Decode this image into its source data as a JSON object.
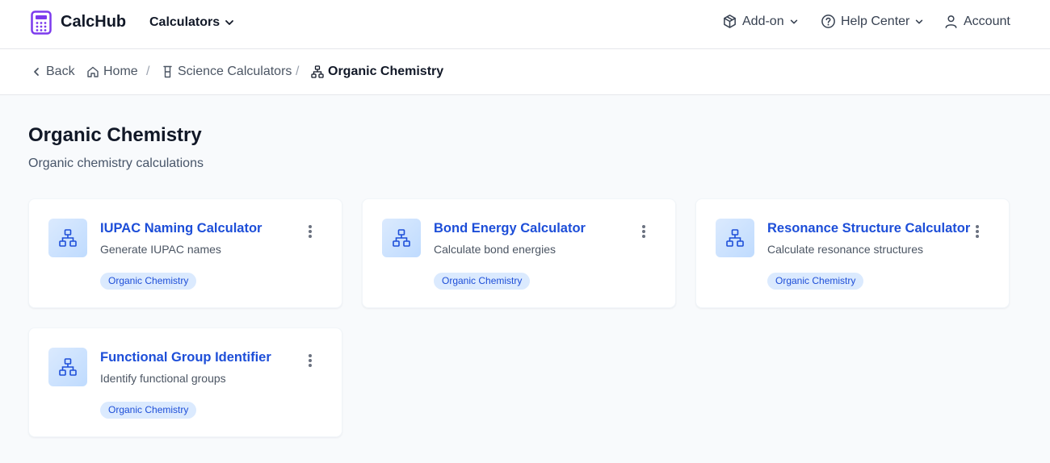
{
  "header": {
    "brand": "CalcHub",
    "calculators_label": "Calculators",
    "addon_label": "Add-on",
    "help_label": "Help Center",
    "account_label": "Account"
  },
  "breadcrumb": {
    "back": "Back",
    "home": "Home",
    "science": "Science Calculators",
    "current": "Organic Chemistry",
    "separator": "/"
  },
  "page": {
    "title": "Organic Chemistry",
    "subtitle": "Organic chemistry calculations"
  },
  "cards": [
    {
      "title": "IUPAC Naming Calculator",
      "description": "Generate IUPAC names",
      "tag": "Organic Chemistry",
      "icon": "hierarchy-icon"
    },
    {
      "title": "Bond Energy Calculator",
      "description": "Calculate bond energies",
      "tag": "Organic Chemistry",
      "icon": "hierarchy-icon"
    },
    {
      "title": "Resonance Structure Calculator",
      "description": "Calculate resonance structures",
      "tag": "Organic Chemistry",
      "icon": "hierarchy-icon"
    },
    {
      "title": "Functional Group Identifier",
      "description": "Identify functional groups",
      "tag": "Organic Chemistry",
      "icon": "hierarchy-icon"
    }
  ],
  "colors": {
    "accent": "#1d4ed8",
    "brand_purple": "#7c3aed",
    "tag_bg": "#dbeafe"
  }
}
